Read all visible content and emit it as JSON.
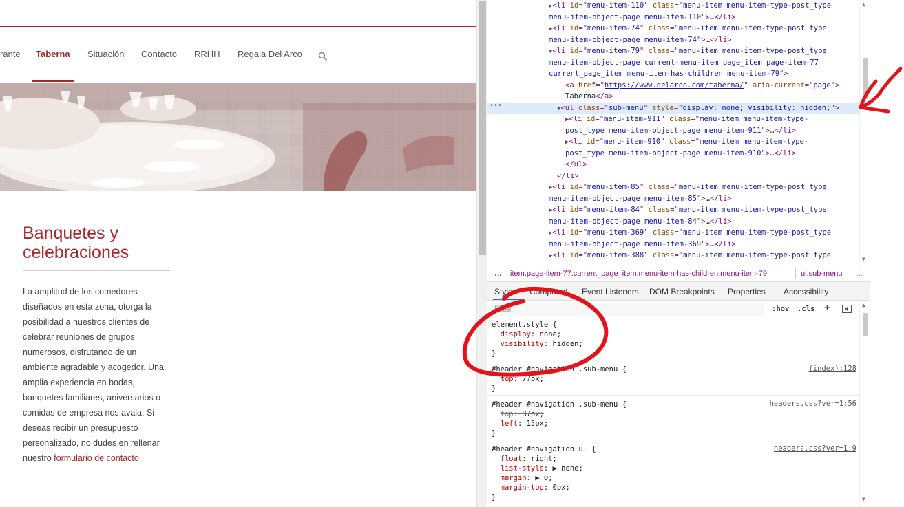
{
  "site": {
    "nav": [
      {
        "label": "rante",
        "active": false
      },
      {
        "label": "Taberna",
        "active": true
      },
      {
        "label": "Situación",
        "active": false
      },
      {
        "label": "Contacto",
        "active": false
      },
      {
        "label": "RRHH",
        "active": false
      },
      {
        "label": "Regala Del Arco",
        "active": false
      }
    ],
    "search_icon": "search-icon",
    "heading_line1": "Banquetes y",
    "heading_line2": "celebraciones",
    "body_lines": [
      "La amplitud de los comedores",
      "diseñados en esta zona, otorga la",
      "posibilidad a nuestros clientes de",
      "celebrar reuniones de grupos",
      "numerosos, disfrutando de un",
      "ambiente agradable y acogedor. Una",
      "amplia experiencia en bodas,",
      "banquetes familiares, aniversarios o",
      "comidas de empresa nos avala. Si",
      "deseas recibir un presupuesto",
      "personalizado, no dudes en rellenar"
    ],
    "body_last_prefix": "nuestro ",
    "body_link": "formulario de contacto",
    "accent": "#a9262d"
  },
  "devtools": {
    "dom_lines": [
      {
        "indent": 0,
        "tri": "▶",
        "parts": [
          [
            "tg",
            "<li "
          ],
          [
            "at",
            "id"
          ],
          [
            "tg",
            "=\""
          ],
          [
            "av",
            "menu-item-110"
          ],
          [
            "tg",
            "\" "
          ],
          [
            "at",
            "class"
          ],
          [
            "tg",
            "=\""
          ],
          [
            "av",
            "menu-item menu-item-type-post_type"
          ]
        ]
      },
      {
        "indent": 0,
        "tri": "",
        "parts": [
          [
            "av",
            "menu-item-object-page menu-item-110"
          ],
          [
            "tg",
            "\">"
          ],
          [
            "tx",
            "…"
          ],
          [
            "tg",
            "</li>"
          ]
        ]
      },
      {
        "indent": 0,
        "tri": "▶",
        "parts": [
          [
            "tg",
            "<li "
          ],
          [
            "at",
            "id"
          ],
          [
            "tg",
            "=\""
          ],
          [
            "av",
            "menu-item-74"
          ],
          [
            "tg",
            "\" "
          ],
          [
            "at",
            "class"
          ],
          [
            "tg",
            "=\""
          ],
          [
            "av",
            "menu-item menu-item-type-post_type"
          ]
        ]
      },
      {
        "indent": 0,
        "tri": "",
        "parts": [
          [
            "av",
            "menu-item-object-page menu-item-74"
          ],
          [
            "tg",
            "\">"
          ],
          [
            "tx",
            "…"
          ],
          [
            "tg",
            "</li>"
          ]
        ]
      },
      {
        "indent": 0,
        "tri": "▼",
        "parts": [
          [
            "tg",
            "<li "
          ],
          [
            "at",
            "id"
          ],
          [
            "tg",
            "=\""
          ],
          [
            "av",
            "menu-item-79"
          ],
          [
            "tg",
            "\" "
          ],
          [
            "at",
            "class"
          ],
          [
            "tg",
            "=\""
          ],
          [
            "av",
            "menu-item menu-item-type-post_type"
          ]
        ]
      },
      {
        "indent": 0,
        "tri": "",
        "parts": [
          [
            "av",
            "menu-item-object-page current-menu-item page_item page-item-77"
          ]
        ]
      },
      {
        "indent": 0,
        "tri": "",
        "parts": [
          [
            "av",
            "current_page_item menu-item-has-children menu-item-79"
          ],
          [
            "tg",
            "\">"
          ]
        ]
      },
      {
        "indent": 2,
        "tri": "",
        "parts": [
          [
            "tg",
            "<a "
          ],
          [
            "at",
            "href"
          ],
          [
            "tg",
            "=\""
          ],
          [
            "avl",
            "https://www.delarco.com/taberna/"
          ],
          [
            "tg",
            "\" "
          ],
          [
            "at",
            "aria-current"
          ],
          [
            "tg",
            "=\""
          ],
          [
            "av",
            "page"
          ],
          [
            "tg",
            "\">"
          ]
        ]
      },
      {
        "indent": 2,
        "tri": "",
        "parts": [
          [
            "tx",
            "Taberna"
          ],
          [
            "tg",
            "</a>"
          ]
        ]
      },
      {
        "indent": 1,
        "tri": "▼",
        "sel": true,
        "parts": [
          [
            "tg",
            "<ul "
          ],
          [
            "at",
            "class"
          ],
          [
            "tg",
            "=\""
          ],
          [
            "av",
            "sub-menu"
          ],
          [
            "tg",
            "\" "
          ],
          [
            "at",
            "style"
          ],
          [
            "tg",
            "=\""
          ],
          [
            "av",
            "display: none; visibility: hidden;"
          ],
          [
            "tg",
            "\">"
          ]
        ]
      },
      {
        "indent": 2,
        "tri": "▶",
        "parts": [
          [
            "tg",
            "<li "
          ],
          [
            "at",
            "id"
          ],
          [
            "tg",
            "=\""
          ],
          [
            "av",
            "menu-item-911"
          ],
          [
            "tg",
            "\" "
          ],
          [
            "at",
            "class"
          ],
          [
            "tg",
            "=\""
          ],
          [
            "av",
            "menu-item menu-item-type-"
          ]
        ]
      },
      {
        "indent": 2,
        "tri": "",
        "parts": [
          [
            "av",
            "post_type menu-item-object-page menu-item-911"
          ],
          [
            "tg",
            "\">"
          ],
          [
            "tx",
            "…"
          ],
          [
            "tg",
            "</li>"
          ]
        ]
      },
      {
        "indent": 2,
        "tri": "▶",
        "parts": [
          [
            "tg",
            "<li "
          ],
          [
            "at",
            "id"
          ],
          [
            "tg",
            "=\""
          ],
          [
            "av",
            "menu-item-910"
          ],
          [
            "tg",
            "\" "
          ],
          [
            "at",
            "class"
          ],
          [
            "tg",
            "=\""
          ],
          [
            "av",
            "menu-item menu-item-type-"
          ]
        ]
      },
      {
        "indent": 2,
        "tri": "",
        "parts": [
          [
            "av",
            "post_type menu-item-object-page menu-item-910"
          ],
          [
            "tg",
            "\">"
          ],
          [
            "tx",
            "…"
          ],
          [
            "tg",
            "</li>"
          ]
        ]
      },
      {
        "indent": 2,
        "tri": "",
        "parts": [
          [
            "tg",
            "</ul>"
          ]
        ]
      },
      {
        "indent": 1,
        "tri": "",
        "parts": [
          [
            "tg",
            "</li>"
          ]
        ]
      },
      {
        "indent": 0,
        "tri": "▶",
        "parts": [
          [
            "tg",
            "<li "
          ],
          [
            "at",
            "id"
          ],
          [
            "tg",
            "=\""
          ],
          [
            "av",
            "menu-item-85"
          ],
          [
            "tg",
            "\" "
          ],
          [
            "at",
            "class"
          ],
          [
            "tg",
            "=\""
          ],
          [
            "av",
            "menu-item menu-item-type-post_type"
          ]
        ]
      },
      {
        "indent": 0,
        "tri": "",
        "parts": [
          [
            "av",
            "menu-item-object-page menu-item-85"
          ],
          [
            "tg",
            "\">"
          ],
          [
            "tx",
            "…"
          ],
          [
            "tg",
            "</li>"
          ]
        ]
      },
      {
        "indent": 0,
        "tri": "▶",
        "parts": [
          [
            "tg",
            "<li "
          ],
          [
            "at",
            "id"
          ],
          [
            "tg",
            "=\""
          ],
          [
            "av",
            "menu-item-84"
          ],
          [
            "tg",
            "\" "
          ],
          [
            "at",
            "class"
          ],
          [
            "tg",
            "=\""
          ],
          [
            "av",
            "menu-item menu-item-type-post_type"
          ]
        ]
      },
      {
        "indent": 0,
        "tri": "",
        "parts": [
          [
            "av",
            "menu-item-object-page menu-item-84"
          ],
          [
            "tg",
            "\">"
          ],
          [
            "tx",
            "…"
          ],
          [
            "tg",
            "</li>"
          ]
        ]
      },
      {
        "indent": 0,
        "tri": "▶",
        "parts": [
          [
            "tg",
            "<li "
          ],
          [
            "at",
            "id"
          ],
          [
            "tg",
            "=\""
          ],
          [
            "av",
            "menu-item-369"
          ],
          [
            "tg",
            "\" "
          ],
          [
            "at",
            "class"
          ],
          [
            "tg",
            "=\""
          ],
          [
            "av",
            "menu-item menu-item-type-post_type"
          ]
        ]
      },
      {
        "indent": 0,
        "tri": "",
        "parts": [
          [
            "av",
            "menu-item-object-page menu-item-369"
          ],
          [
            "tg",
            "\">"
          ],
          [
            "tx",
            "…"
          ],
          [
            "tg",
            "</li>"
          ]
        ]
      },
      {
        "indent": 0,
        "tri": "▶",
        "parts": [
          [
            "tg",
            "<li "
          ],
          [
            "at",
            "id"
          ],
          [
            "tg",
            "=\""
          ],
          [
            "av",
            "menu-item-388"
          ],
          [
            "tg",
            "\" "
          ],
          [
            "at",
            "class"
          ],
          [
            "tg",
            "=\""
          ],
          [
            "av",
            "menu-item menu-item-type-post_type"
          ]
        ]
      }
    ],
    "dom_gutter_dots": "•••",
    "breadcrumb_dots": "…",
    "breadcrumb_a": ".item.page-item-77.current_page_item.menu-item-has-children.menu-item-79",
    "breadcrumb_b": "ul.sub-menu",
    "breadcrumb_more": "…",
    "tabs": [
      "Styles",
      "Computed",
      "Event Listeners",
      "DOM Breakpoints",
      "Properties",
      "Accessibility"
    ],
    "filter_placeholder": "Filter",
    "hov": ":hov",
    "cls": ".cls",
    "plus": "+",
    "rules": [
      {
        "selector": "element.style {",
        "source": "",
        "decls": [
          [
            "display",
            "none",
            false
          ],
          [
            "visibility",
            "hidden",
            false
          ]
        ],
        "close": "}"
      },
      {
        "selector": "#header #navigation .sub-menu {",
        "source": "(index):128",
        "decls": [
          [
            "top",
            "77px",
            false
          ]
        ],
        "close": "}"
      },
      {
        "selector": "#header #navigation .sub-menu {",
        "source": "headers.css?ver=1:56",
        "decls": [
          [
            "top",
            "87px",
            true
          ],
          [
            "left",
            "15px",
            false
          ]
        ],
        "close": "}"
      },
      {
        "selector": "#header #navigation ul {",
        "source": "headers.css?ver=1:9",
        "decls": [
          [
            "float",
            "right",
            false
          ],
          [
            "list-style",
            "▶ none",
            false
          ],
          [
            "margin",
            "▶ 0",
            false
          ],
          [
            "margin-top",
            "0px",
            false
          ]
        ],
        "close": "}"
      }
    ]
  }
}
